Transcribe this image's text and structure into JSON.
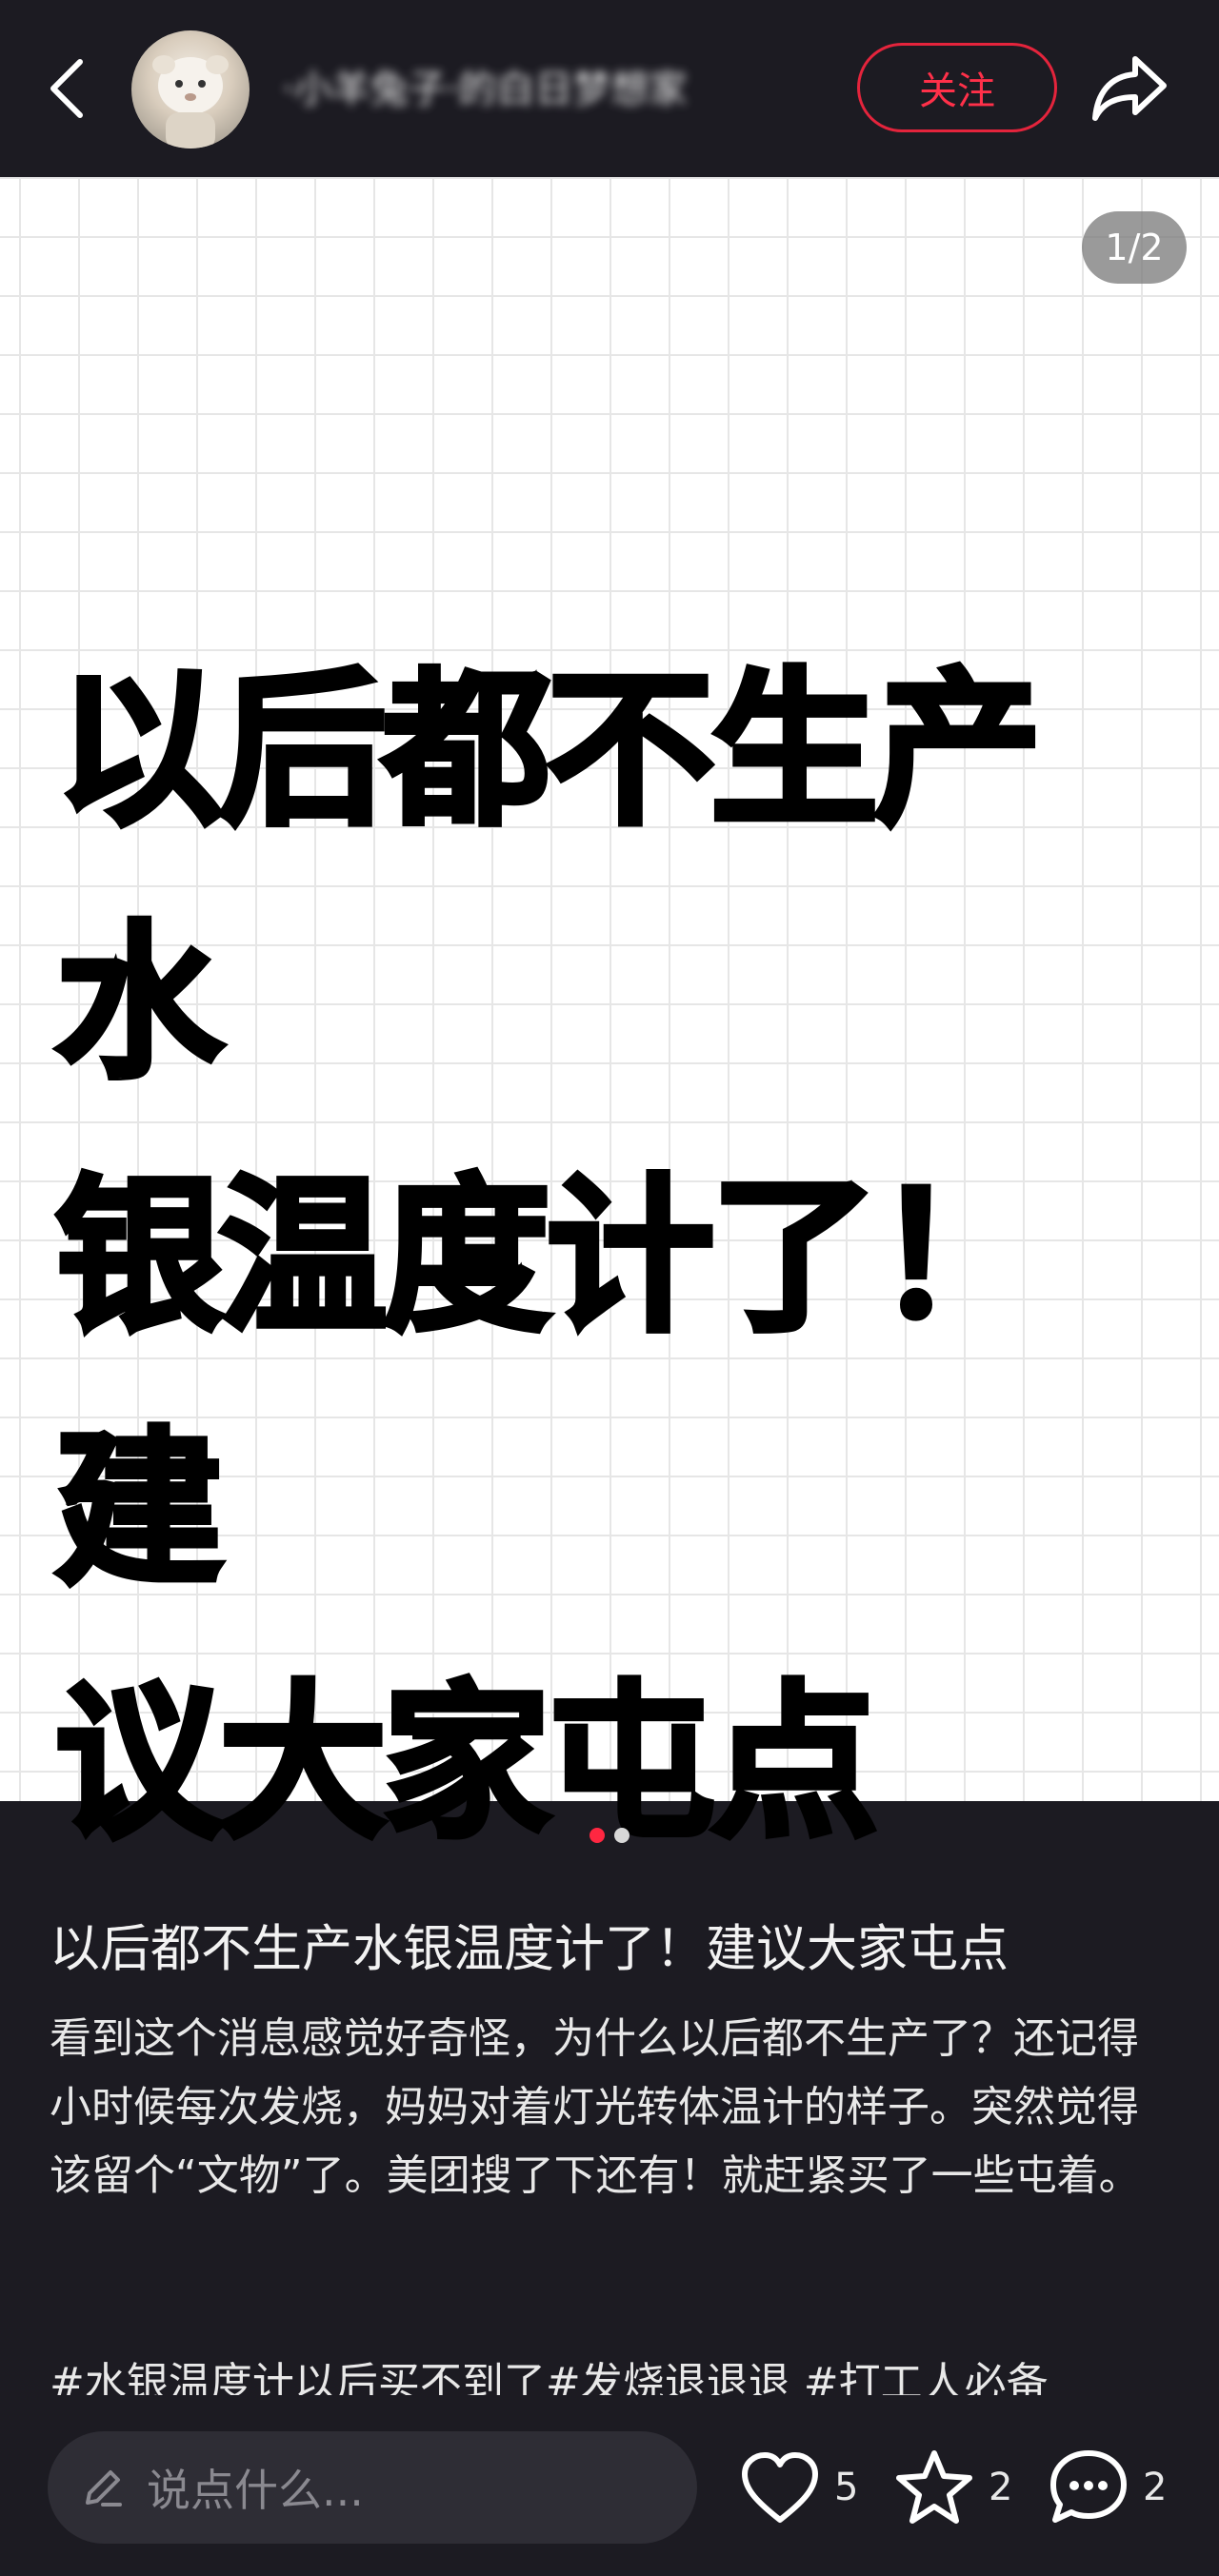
{
  "header": {
    "username": "·小羊兔子·的白日梦想家",
    "follow_label": "关注",
    "icons": [
      "back-arrow-icon",
      "avatar",
      "share-icon"
    ]
  },
  "image": {
    "counter": "1/2",
    "headline_lines": [
      "以后都不生产水",
      "银温度计了！ 建",
      "议大家屯点"
    ]
  },
  "pager": {
    "total": 2,
    "active": 1
  },
  "post": {
    "title": "以后都不生产水银温度计了！建议大家屯点",
    "body": "看到这个消息感觉好奇怪，为什么以后都不生产了？还记得小时候每次发烧，妈妈对着灯光转体温计的样子。突然觉得该留个“文物”了。美团搜了下还有！就赶紧买了一些屯着。",
    "hashtags": [
      "#水银温度计以后买不到了",
      "#发烧退退退",
      " #打工人必备"
    ]
  },
  "bottom": {
    "comment_placeholder": "说点什么...",
    "likes": "5",
    "stars": "2",
    "comments": "2"
  },
  "colors": {
    "accent": "#ff2741",
    "background": "#1c1b22",
    "input_bg": "#2e2d35"
  }
}
